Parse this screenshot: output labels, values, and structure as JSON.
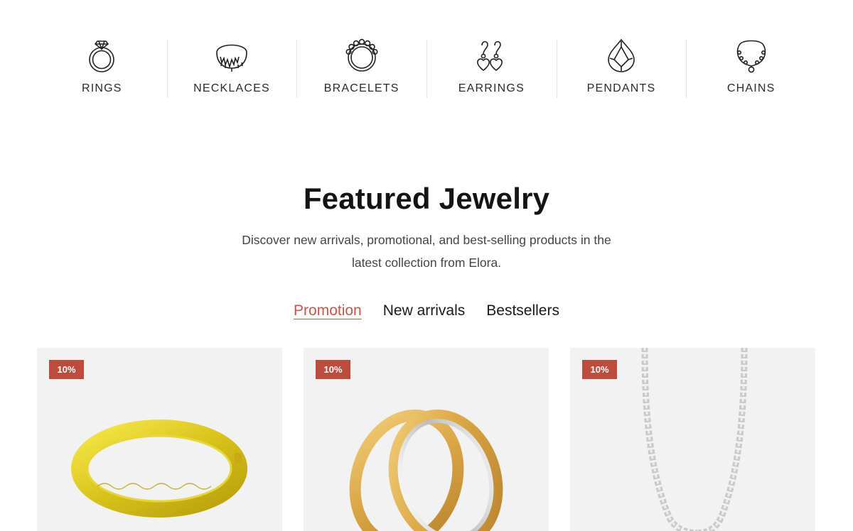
{
  "categories": [
    {
      "label": "RINGS",
      "icon": "ring-icon"
    },
    {
      "label": "NECKLACES",
      "icon": "necklace-icon"
    },
    {
      "label": "BRACELETS",
      "icon": "bracelet-icon"
    },
    {
      "label": "EARRINGS",
      "icon": "earrings-icon"
    },
    {
      "label": "PENDANTS",
      "icon": "pendant-icon"
    },
    {
      "label": "CHAINS",
      "icon": "chain-icon"
    }
  ],
  "featured": {
    "title": "Featured Jewelry",
    "subtitle": "Discover new arrivals, promotional, and best-selling products in the latest collection from Elora."
  },
  "tabs": [
    {
      "label": "Promotion",
      "active": true
    },
    {
      "label": "New arrivals",
      "active": false
    },
    {
      "label": "Bestsellers",
      "active": false
    }
  ],
  "products": [
    {
      "badge": "10%",
      "image": "gold-bangle"
    },
    {
      "badge": "10%",
      "image": "two-tone-rings"
    },
    {
      "badge": "10%",
      "image": "silver-bead-chain"
    }
  ],
  "colors": {
    "accent": "#c0584a",
    "badge": "#bd4c3f",
    "card_bg": "#f2f2f2"
  }
}
